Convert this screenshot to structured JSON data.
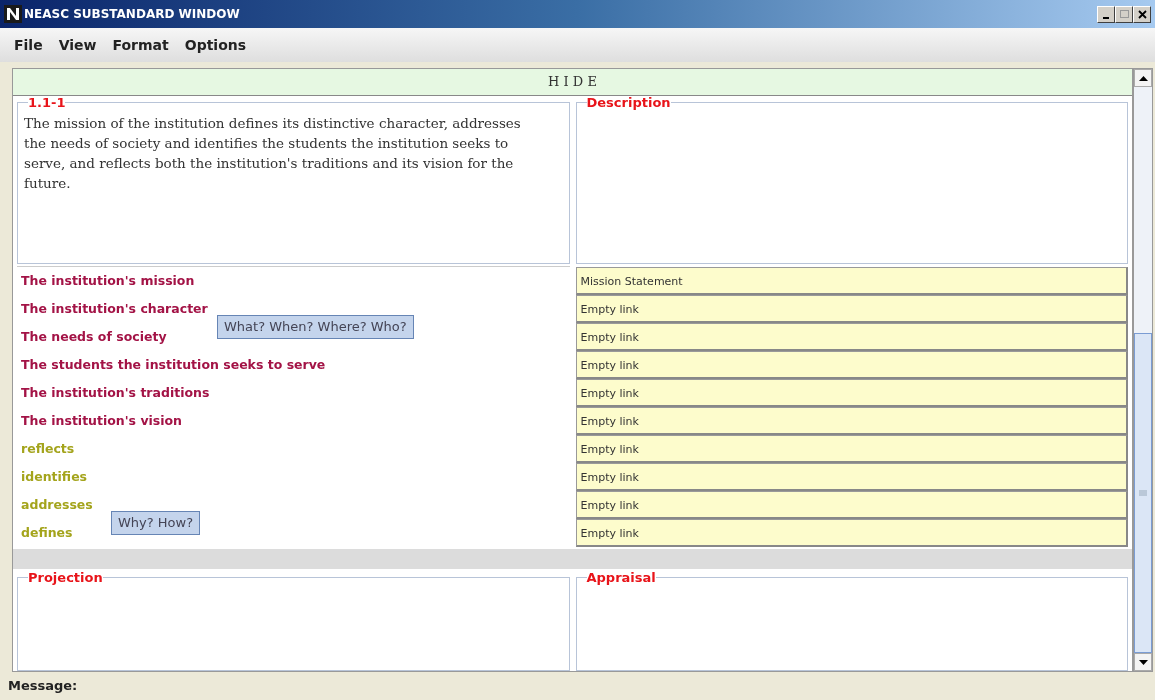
{
  "window": {
    "title": "NEASC SUBSTANDARD WINDOW"
  },
  "menu": [
    "File",
    "View",
    "Format",
    "Options"
  ],
  "hide_bar": {
    "label": "H I D E"
  },
  "standard": {
    "title": "1.1-1",
    "text": "The mission of the institution defines its distinctive character, addresses the needs of society and identifies the students the institution seeks to serve, and reflects both the institution's traditions and its vision for the future."
  },
  "description": {
    "title": "Description"
  },
  "terms": [
    {
      "text": "The institution's mission",
      "kind": "concept"
    },
    {
      "text": "The institution's character",
      "kind": "concept"
    },
    {
      "text": "The needs of society",
      "kind": "concept"
    },
    {
      "text": "The students the institution seeks to serve",
      "kind": "concept"
    },
    {
      "text": "The institution's traditions",
      "kind": "concept"
    },
    {
      "text": "The institution's vision",
      "kind": "concept"
    },
    {
      "text": "reflects",
      "kind": "action"
    },
    {
      "text": "identifies",
      "kind": "action"
    },
    {
      "text": "addresses",
      "kind": "action"
    },
    {
      "text": "defines",
      "kind": "action"
    }
  ],
  "tooltips": [
    {
      "text": "What? When? Where? Who?",
      "kind": "concepts"
    },
    {
      "text": "Why? How?",
      "kind": "actions"
    }
  ],
  "links": [
    "Mission Statement",
    "Empty link",
    "Empty link",
    "Empty link",
    "Empty link",
    "Empty link",
    "Empty link",
    "Empty link",
    "Empty link",
    "Empty link"
  ],
  "projection": {
    "title": "Projection"
  },
  "appraisal": {
    "title": "Appraisal"
  },
  "status_bar": {
    "label": "Message:"
  }
}
